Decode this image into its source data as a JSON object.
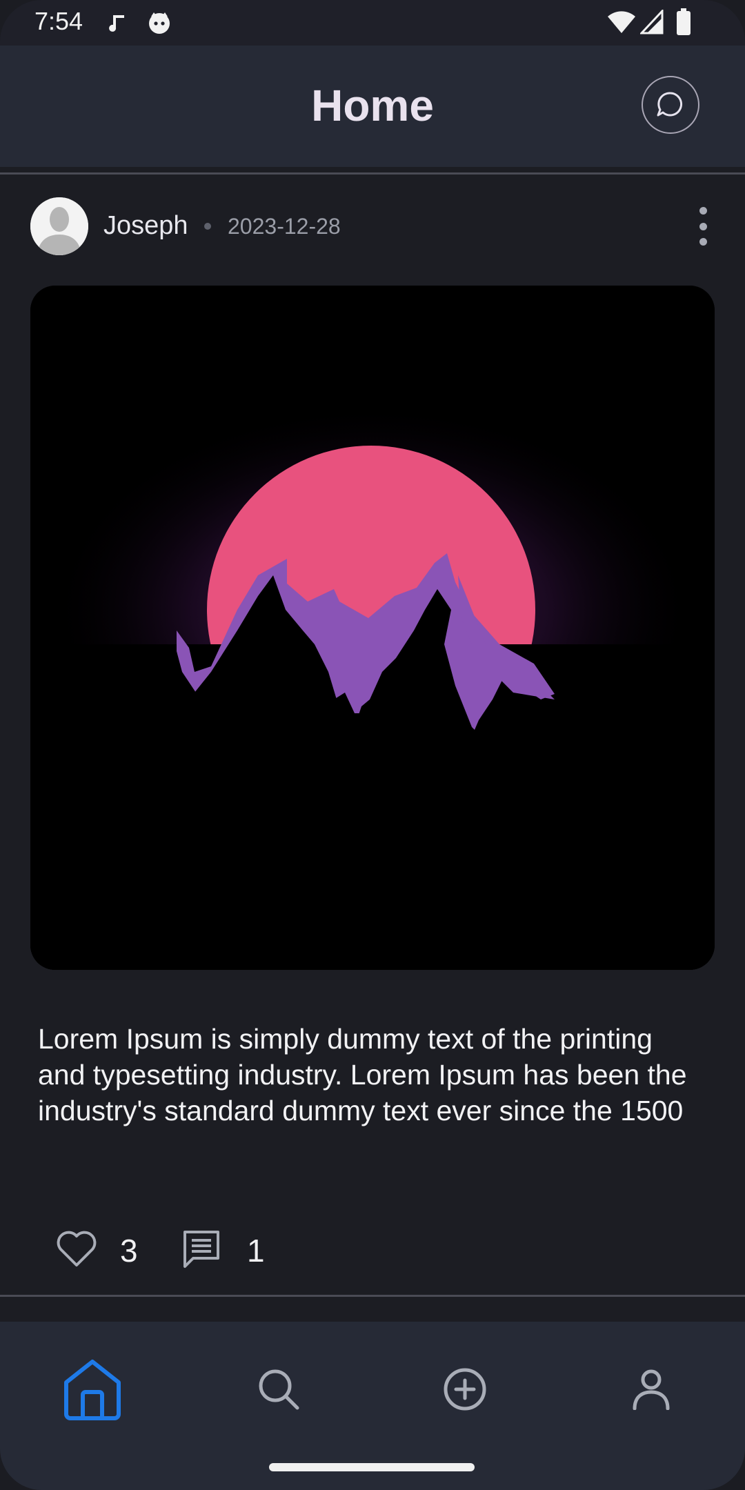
{
  "status_bar": {
    "time": "7:54"
  },
  "app_bar": {
    "title": "Home",
    "chat_icon": "chat-bubble-icon"
  },
  "post": {
    "author": "Joseph",
    "date": "2023-12-28",
    "image_alt_icon": "mountain-sunset-image",
    "text": "Lorem Ipsum is simply dummy text of the printing and typesetting industry. Lorem Ipsum has been the industry's standard dummy text ever since the 1500",
    "likes": "3",
    "comments": "1"
  },
  "bottom_nav": {
    "items": [
      {
        "icon": "home-icon",
        "active": true
      },
      {
        "icon": "search-icon",
        "active": false
      },
      {
        "icon": "add-circle-icon",
        "active": false
      },
      {
        "icon": "profile-icon",
        "active": false
      }
    ]
  },
  "colors": {
    "accent": "#1e7ae8",
    "background": "#1c1d23",
    "bar": "#262a36",
    "sun": "#e8527e",
    "mountain": "#8a54b6"
  }
}
